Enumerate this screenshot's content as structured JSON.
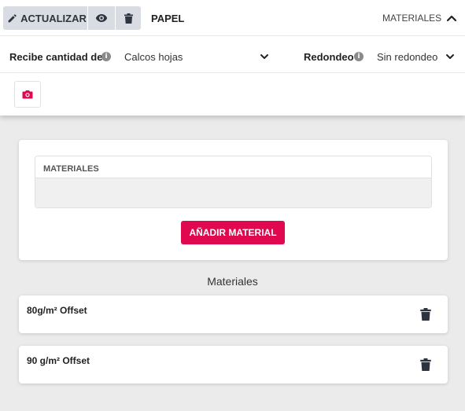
{
  "toolbar": {
    "update_label": "ACTUALIZAR",
    "section_title": "PAPEL",
    "section_tag": "MATERIALES"
  },
  "options": {
    "quantity_label": "Recibe cantidad de",
    "quantity_value": "Calcos hojas",
    "rounding_label": "Redondeo",
    "rounding_value": "Sin redondeo"
  },
  "materials_panel": {
    "header": "MATERIALES",
    "add_button": "AÑADIR MATERIAL"
  },
  "materials_list": {
    "title": "Materiales",
    "items": [
      {
        "label": "80g/m² Offset"
      },
      {
        "label": "90 g/m² Offset"
      }
    ]
  },
  "colors": {
    "accent": "#e0094f",
    "toolbar_button": "#d9dde3",
    "background": "#ebebeb"
  },
  "icons": [
    "pencil-icon",
    "eye-icon",
    "trash-icon",
    "chevron-up-icon",
    "info-icon",
    "chevron-down-icon",
    "camera-icon"
  ]
}
